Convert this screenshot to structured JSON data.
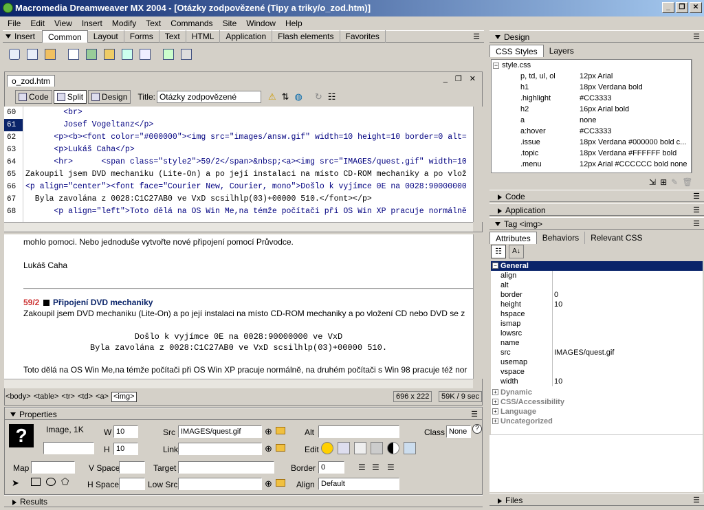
{
  "title": "Macromedia Dreamweaver MX 2004 - [Otázky zodpovězené (Tipy a triky/o_zod.htm)]",
  "menu": [
    "File",
    "Edit",
    "View",
    "Insert",
    "Modify",
    "Text",
    "Commands",
    "Site",
    "Window",
    "Help"
  ],
  "insert_bar": {
    "label": "Insert",
    "tabs": [
      "Common",
      "Layout",
      "Forms",
      "Text",
      "HTML",
      "Application",
      "Flash elements",
      "Favorites"
    ],
    "active": "Common"
  },
  "document": {
    "tab": "o_zod.htm",
    "view_buttons": [
      "Code",
      "Split",
      "Design"
    ],
    "title_label": "Title:",
    "title_value": "Otázky zodpovězené",
    "code_lines": [
      {
        "n": "60",
        "text": "        <br>"
      },
      {
        "n": "61",
        "text": "        Josef Vogeltanz</p>"
      },
      {
        "n": "62",
        "text": "      <p><b><font color=\"#000000\"><img src=\"images/answ.gif\" width=10 height=10 border=0 alt="
      },
      {
        "n": "63",
        "text": "      <p>Lukáš Caha</p>"
      },
      {
        "n": "64",
        "text": "      <hr>      <span class=\"style2\">59/2</span>&nbsp;<a><img src=\"IMAGES/quest.gif\" width=10"
      },
      {
        "n": "65",
        "text": "Zakoupil jsem DVD mechaniku (Lite-On) a po její instalaci na místo CD-ROM mechaniky a po vlož"
      },
      {
        "n": "66",
        "text": "<p align=\"center\"><font face=\"Courier New, Courier, mono\">Došlo k vyjímce 0E na 0028:90000000"
      },
      {
        "n": "67",
        "text": "  Byla zavolána z 0028:C1C27AB0 ve VxD scsilhlp(03)+00000 510.</font></p>"
      },
      {
        "n": "68",
        "text": "      <p align=\"left\">Toto dělá na OS Win Me,na témže počítači při OS Win XP pracuje normálně"
      }
    ],
    "design": {
      "line1": "mohlo pomoci. Nebo jednoduše vytvořte nové připojení pomocí Průvodce.",
      "author": "Lukáš Caha",
      "num": "59/2",
      "heading": "Připojení DVD mechaniky",
      "para": "Zakoupil jsem DVD mechaniku (Lite-On) a po její instalaci na místo CD-ROM mechaniky a po vložení CD nebo DVD se z",
      "err1": "Došlo k vyjímce 0E na 0028:90000000 ve VxD",
      "err2": "Byla zavolána z 0028:C1C27AB0 ve VxD scsilhlp(03)+00000 510.",
      "para2": "Toto dělá na OS Win Me,na témže počítači při OS Win XP pracuje normálně, na druhém počítači s Win 98 pracuje též nor"
    },
    "status_tags": [
      "<body>",
      "<table>",
      "<tr>",
      "<td>",
      "<a>",
      "<img>"
    ],
    "status_size": "696 x 222",
    "status_weight": "59K / 9 sec"
  },
  "properties": {
    "header": "Properties",
    "image_label": "Image, 1K",
    "w": "10",
    "h": "10",
    "src": "IMAGES/quest.gif",
    "link": "",
    "alt": "",
    "class": "None",
    "map": "",
    "vspace": "",
    "hspace": "",
    "target": "",
    "border": "0",
    "lowsrc": "",
    "align": "Default",
    "labels": {
      "w": "W",
      "h": "H",
      "src": "Src",
      "link": "Link",
      "alt": "Alt",
      "class": "Class",
      "map": "Map",
      "vspace": "V Space",
      "hspace": "H Space",
      "target": "Target",
      "border": "Border",
      "lowsrc": "Low Src",
      "align": "Align",
      "edit": "Edit"
    }
  },
  "results": "Results",
  "right_panel": {
    "design": "Design",
    "design_tabs": [
      "CSS Styles",
      "Layers"
    ],
    "css_root": "style.css",
    "css_rules": [
      {
        "sel": "p, td, ul, ol",
        "val": "12px Arial"
      },
      {
        "sel": "h1",
        "val": "18px Verdana bold"
      },
      {
        "sel": ".highlight",
        "val": "#CC3333"
      },
      {
        "sel": "h2",
        "val": "16px Arial bold"
      },
      {
        "sel": "a",
        "val": "none"
      },
      {
        "sel": "a:hover",
        "val": "#CC3333"
      },
      {
        "sel": ".issue",
        "val": "18px Verdana #000000 bold c..."
      },
      {
        "sel": ".topic",
        "val": "18px Verdana #FFFFFF bold"
      },
      {
        "sel": ".menu",
        "val": "12px Arial #CCCCCC bold none"
      }
    ],
    "code": "Code",
    "application": "Application",
    "tag_panel": "Tag <img>",
    "tag_tabs": [
      "Attributes",
      "Behaviors",
      "Relevant CSS"
    ],
    "general": "General",
    "attributes": [
      {
        "k": "align",
        "v": ""
      },
      {
        "k": "alt",
        "v": ""
      },
      {
        "k": "border",
        "v": "0"
      },
      {
        "k": "height",
        "v": "10"
      },
      {
        "k": "hspace",
        "v": ""
      },
      {
        "k": "ismap",
        "v": ""
      },
      {
        "k": "lowsrc",
        "v": ""
      },
      {
        "k": "name",
        "v": ""
      },
      {
        "k": "src",
        "v": "IMAGES/quest.gif"
      },
      {
        "k": "usemap",
        "v": ""
      },
      {
        "k": "vspace",
        "v": ""
      },
      {
        "k": "width",
        "v": "10"
      }
    ],
    "categories": [
      "Dynamic",
      "CSS/Accessibility",
      "Language",
      "Uncategorized"
    ],
    "files": "Files"
  }
}
